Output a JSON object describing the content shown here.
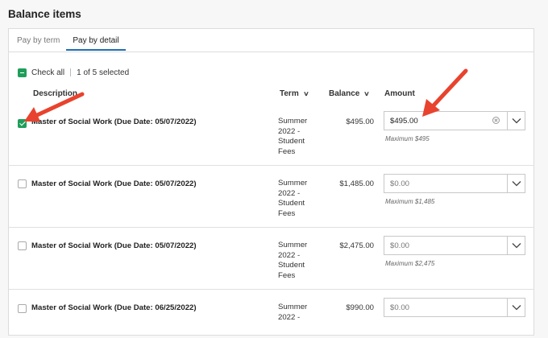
{
  "page_title": "Balance items",
  "tabs": [
    {
      "label": "Pay by term",
      "active": false
    },
    {
      "label": "Pay by detail",
      "active": true
    }
  ],
  "check_all": {
    "label": "Check all",
    "selected_text": "1 of 5 selected"
  },
  "columns": {
    "description": "Description",
    "term": "Term",
    "balance": "Balance",
    "amount": "Amount"
  },
  "rows": [
    {
      "description": "Master of Social Work (Due Date: 05/07/2022)",
      "term_lines": [
        "Summer",
        "2022 -",
        "Student",
        "Fees"
      ],
      "balance": "$495.00",
      "amount": "$495.00",
      "max": "Maximum $495",
      "checked": true
    },
    {
      "description": "Master of Social Work (Due Date: 05/07/2022)",
      "term_lines": [
        "Summer",
        "2022 -",
        "Student",
        "Fees"
      ],
      "balance": "$1,485.00",
      "amount": "$0.00",
      "max": "Maximum $1,485",
      "checked": false
    },
    {
      "description": "Master of Social Work (Due Date: 05/07/2022)",
      "term_lines": [
        "Summer",
        "2022 -",
        "Student",
        "Fees"
      ],
      "balance": "$2,475.00",
      "amount": "$0.00",
      "max": "Maximum $2,475",
      "checked": false
    },
    {
      "description": "Master of Social Work (Due Date: 06/25/2022)",
      "term_lines": [
        "Summer",
        "2022 -"
      ],
      "balance": "$990.00",
      "amount": "$0.00",
      "max": "",
      "checked": false
    }
  ],
  "colors": {
    "accent_green": "#1f9e5a",
    "tab_underline": "#1f6fb2",
    "annotation_arrow": "#e8432e"
  },
  "annotations": [
    "red-arrow-to-checkbox",
    "red-arrow-to-amount"
  ]
}
